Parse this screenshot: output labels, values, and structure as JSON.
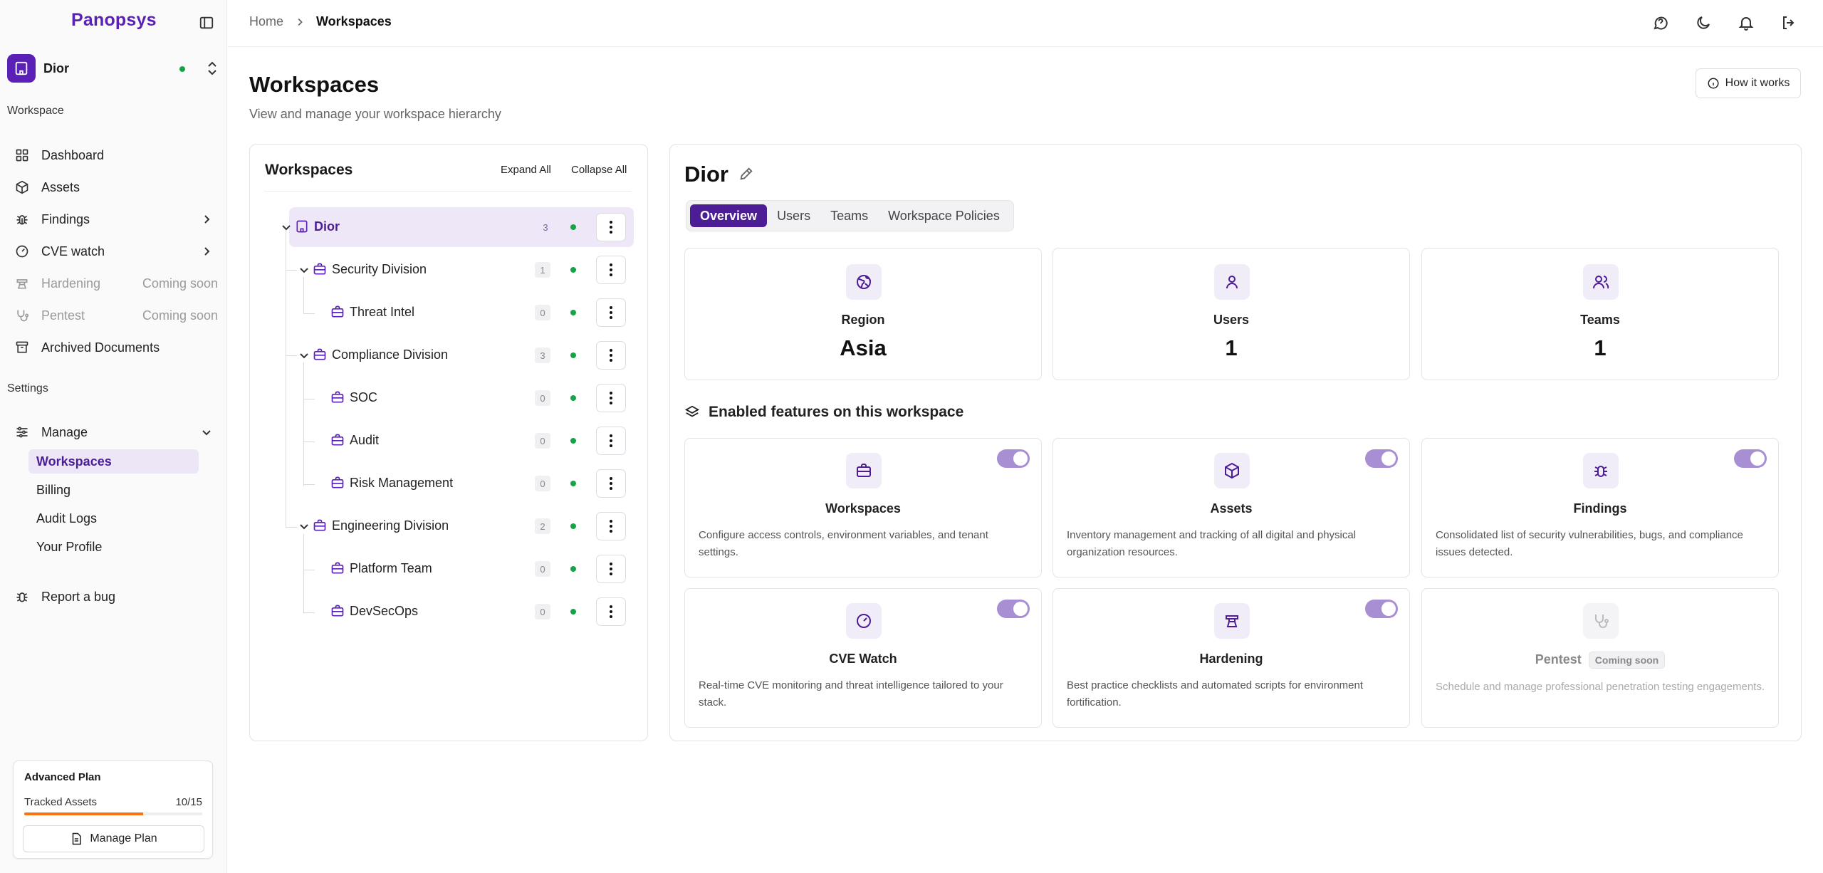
{
  "brand": {
    "logo": "Panopsys"
  },
  "workspace_switcher": {
    "name": "Dior"
  },
  "sidebar": {
    "workspace_label": "Workspace",
    "items": [
      {
        "label": "Dashboard"
      },
      {
        "label": "Assets"
      },
      {
        "label": "Findings"
      },
      {
        "label": "CVE watch"
      },
      {
        "label": "Hardening",
        "badge": "Coming soon"
      },
      {
        "label": "Pentest",
        "badge": "Coming soon"
      },
      {
        "label": "Archived Documents"
      }
    ],
    "settings_label": "Settings",
    "manage": {
      "label": "Manage",
      "children": [
        {
          "label": "Workspaces"
        },
        {
          "label": "Billing"
        },
        {
          "label": "Audit Logs"
        },
        {
          "label": "Your Profile"
        }
      ]
    },
    "report_bug": "Report a bug"
  },
  "plan": {
    "title": "Advanced Plan",
    "metric_label": "Tracked Assets",
    "metric_value": "10/15",
    "progress": 0.6667,
    "button": "Manage Plan",
    "progress_color": "#f97316"
  },
  "breadcrumb": {
    "home": "Home",
    "current": "Workspaces"
  },
  "page": {
    "title": "Workspaces",
    "subtitle": "View and manage your workspace hierarchy",
    "how_it_works": "How it works"
  },
  "tree": {
    "title": "Workspaces",
    "expand_all": "Expand All",
    "collapse_all": "Collapse All",
    "nodes": [
      {
        "name": "Dior",
        "count": "3"
      },
      {
        "name": "Security Division",
        "count": "1"
      },
      {
        "name": "Threat Intel",
        "count": "0"
      },
      {
        "name": "Compliance Division",
        "count": "3"
      },
      {
        "name": "SOC",
        "count": "0"
      },
      {
        "name": "Audit",
        "count": "0"
      },
      {
        "name": "Risk Management",
        "count": "0"
      },
      {
        "name": "Engineering Division",
        "count": "2"
      },
      {
        "name": "Platform Team",
        "count": "0"
      },
      {
        "name": "DevSecOps",
        "count": "0"
      }
    ]
  },
  "detail": {
    "title": "Dior",
    "tabs": [
      "Overview",
      "Users",
      "Teams",
      "Workspace Policies"
    ],
    "stats": [
      {
        "label": "Region",
        "value": "Asia"
      },
      {
        "label": "Users",
        "value": "1"
      },
      {
        "label": "Teams",
        "value": "1"
      }
    ],
    "features_heading": "Enabled features on this workspace",
    "features": [
      {
        "name": "Workspaces",
        "desc": "Configure access controls, environment variables, and tenant settings.",
        "enabled": true
      },
      {
        "name": "Assets",
        "desc": "Inventory management and tracking of all digital and physical organization resources.",
        "enabled": true
      },
      {
        "name": "Findings",
        "desc": "Consolidated list of security vulnerabilities, bugs, and compliance issues detected.",
        "enabled": true
      },
      {
        "name": "CVE Watch",
        "desc": "Real-time CVE monitoring and threat intelligence tailored to your stack.",
        "enabled": true
      },
      {
        "name": "Hardening",
        "desc": "Best practice checklists and automated scripts for environment fortification.",
        "enabled": true
      },
      {
        "name": "Pentest",
        "badge": "Coming soon",
        "desc": "Schedule and manage professional penetration testing engagements.",
        "enabled": false
      }
    ]
  },
  "colors": {
    "accent": "#4c1d95",
    "accent_soft": "#ede7f7",
    "toggle_on": "#a88fd4",
    "status_green": "#16a34a"
  }
}
